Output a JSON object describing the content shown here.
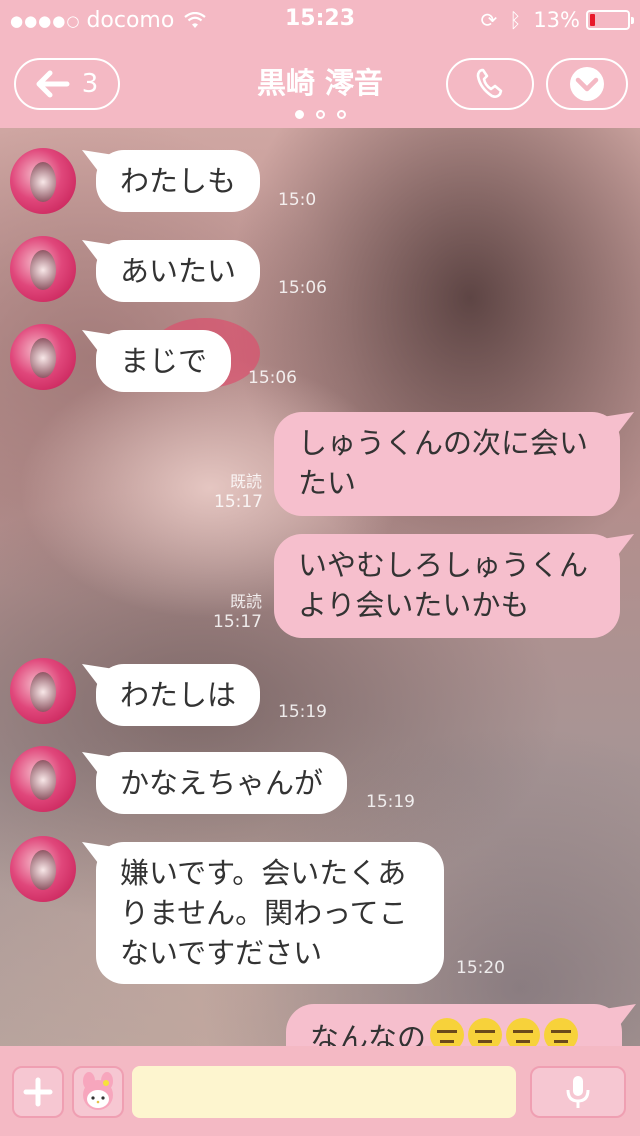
{
  "status_bar": {
    "signal": "●●●●○",
    "carrier": "docomo",
    "time": "15:23",
    "battery_text": "13%",
    "battery_level": 0.13,
    "battery_color": "#e8182a"
  },
  "header": {
    "back_arrow": "🡐",
    "back_count": "3",
    "title": "黒崎 澪音",
    "icons": [
      "wifi-icon",
      "rotation-lock-icon",
      "bluetooth-icon",
      "back-arrow-icon",
      "phone-icon",
      "chevron-down-icon"
    ]
  },
  "messages": [
    {
      "dir": "in",
      "lines": [
        "わたしも"
      ],
      "time": "15:0"
    },
    {
      "dir": "in",
      "lines": [
        "あいたい"
      ],
      "time": "15:06"
    },
    {
      "dir": "in",
      "lines": [
        "まじで"
      ],
      "time": "15:06"
    },
    {
      "dir": "out",
      "lines": [
        "しゅうくんの次に会い",
        "たい"
      ],
      "read": "既読",
      "time": "15:17"
    },
    {
      "dir": "out",
      "lines": [
        "いやむしろしゅうくん",
        "より会いたいかも"
      ],
      "read": "既読",
      "time": "15:17"
    },
    {
      "dir": "in",
      "lines": [
        "わたしは"
      ],
      "time": "15:19"
    },
    {
      "dir": "in",
      "lines": [
        "かなえちゃんが"
      ],
      "time": "15:19"
    },
    {
      "dir": "in",
      "lines": [
        "嫌いです。会いたくあ",
        "りません。関わってこ",
        "ないですださい"
      ],
      "time": "15:20"
    },
    {
      "dir": "out",
      "lines": [
        "なんなの"
      ],
      "emoji_count": 4,
      "emoji": "expressionless-face-icon"
    }
  ],
  "input": {
    "placeholder": ""
  },
  "colors": {
    "bar_pink": "#f4b9c4",
    "outgoing_bubble": "#f6bfcd",
    "incoming_bubble": "#ffffff",
    "input_field": "#fdf5cf"
  }
}
